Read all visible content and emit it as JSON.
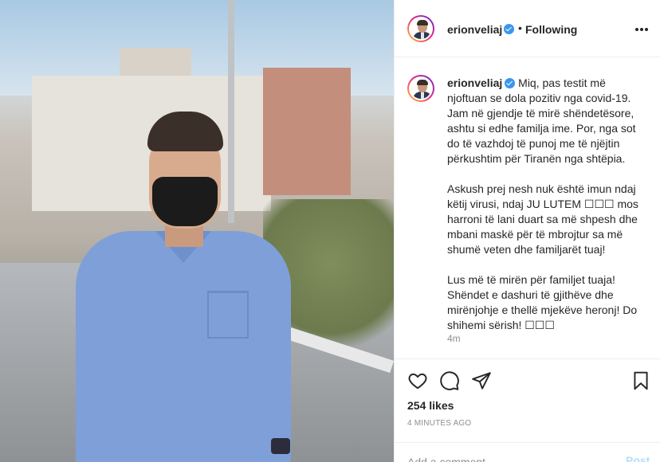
{
  "post": {
    "username": "erionveliaj",
    "follow_status": "Following",
    "separator": "•",
    "caption_paragraphs": [
      "Miq, pas testit më njoftuan se dola pozitiv nga covid-19. Jam në gjendje të mirë shëndetësore, ashtu si edhe familja ime. Por, nga sot do të vazhdoj të punoj me të njëjtin përkushtim për Tiranën nga shtëpia.",
      "Askush prej nesh nuk është imun ndaj këtij virusi, ndaj JU LUTEM ☐☐☐ mos harroni të lani duart sa më shpesh dhe mbani maskë për të mbrojtur sa më shumë veten dhe familjarët tuaj!",
      "Lus më të mirën për familjet tuaja! Shëndet e dashuri të gjithëve dhe mirënjohje e thellë mjekëve heronj! Do shihemi sërish! ☐☐☐"
    ],
    "caption_time": "4m",
    "likes": "254 likes",
    "timestamp": "4 minutes ago"
  },
  "comment": {
    "placeholder": "Add a comment...",
    "post_label": "Post"
  },
  "icons": {
    "more": "more-options-icon",
    "like": "heart-icon",
    "comment": "comment-icon",
    "share": "paper-plane-icon",
    "save": "bookmark-icon",
    "verified": "verified-badge-icon"
  },
  "colors": {
    "verified": "#3897f0",
    "post_button": "#b2dffc",
    "muted_text": "#8e8e8e",
    "text": "#262626"
  }
}
